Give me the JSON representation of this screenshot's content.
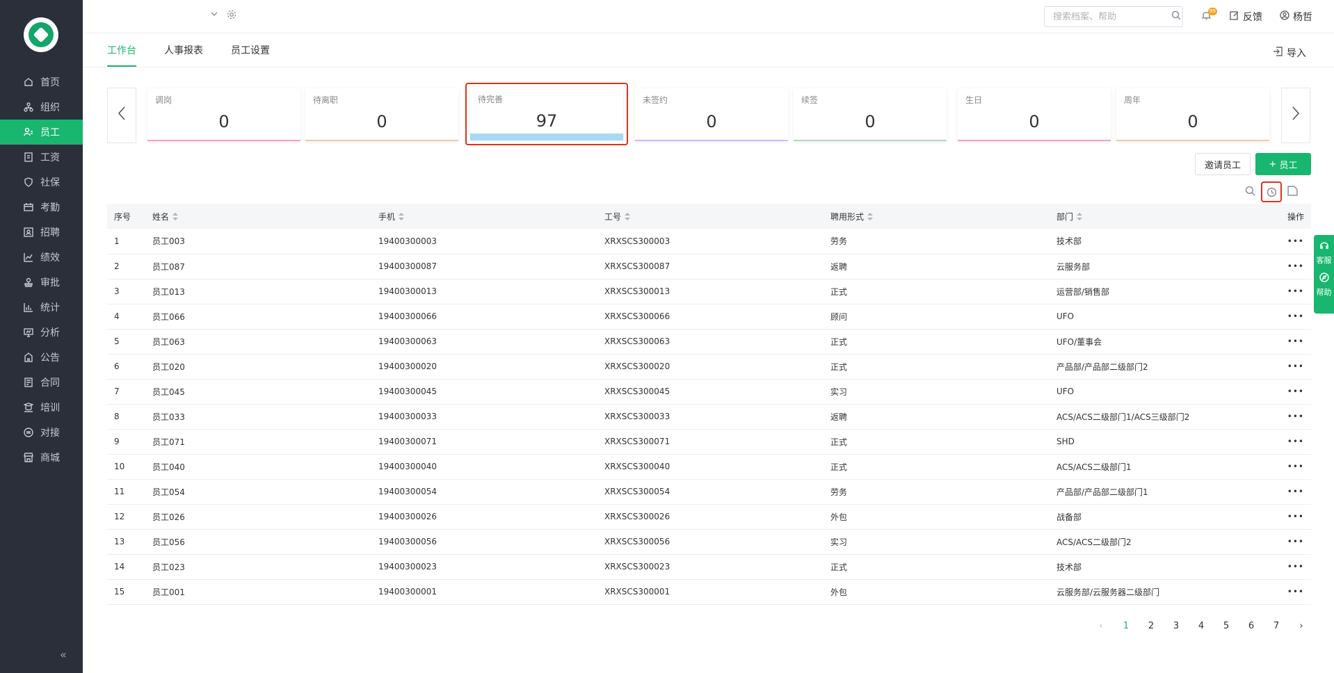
{
  "sidebar": {
    "items": [
      {
        "label": "首页",
        "icon": "home-icon"
      },
      {
        "label": "组织",
        "icon": "org-icon"
      },
      {
        "label": "员工",
        "icon": "employee-icon",
        "active": true
      },
      {
        "label": "工资",
        "icon": "salary-icon"
      },
      {
        "label": "社保",
        "icon": "shield-icon"
      },
      {
        "label": "考勤",
        "icon": "calendar-icon"
      },
      {
        "label": "招聘",
        "icon": "recruit-icon"
      },
      {
        "label": "绩效",
        "icon": "chart-line-icon"
      },
      {
        "label": "审批",
        "icon": "stamp-icon"
      },
      {
        "label": "统计",
        "icon": "bar-chart-icon"
      },
      {
        "label": "分析",
        "icon": "analysis-icon"
      },
      {
        "label": "公告",
        "icon": "notice-icon"
      },
      {
        "label": "合同",
        "icon": "contract-icon"
      },
      {
        "label": "培训",
        "icon": "training-icon"
      },
      {
        "label": "对接",
        "icon": "link-icon"
      },
      {
        "label": "商城",
        "icon": "store-icon"
      }
    ]
  },
  "header": {
    "search_placeholder": "搜索档案、帮助",
    "bell_badge": "99",
    "feedback_label": "反馈",
    "user_name": "杨哲"
  },
  "tabs": [
    {
      "label": "工作台",
      "active": true
    },
    {
      "label": "人事报表"
    },
    {
      "label": "员工设置"
    }
  ],
  "import_label": "导入",
  "cards": [
    {
      "label": "调岗",
      "value": "0",
      "color": "#f5a3b8"
    },
    {
      "label": "待离职",
      "value": "0",
      "color": "#f8c8a8"
    },
    {
      "label": "待完善",
      "value": "97",
      "color": "#a7d9f5"
    },
    {
      "label": "未签约",
      "value": "0",
      "color": "#d8b4f8"
    },
    {
      "label": "续签",
      "value": "0",
      "color": "#a8dcc0"
    },
    {
      "label": "生日",
      "value": "0",
      "color": "#f5a3b8"
    },
    {
      "label": "周年",
      "value": "0",
      "color": "#f8c8a8"
    }
  ],
  "actions": {
    "invite_label": "邀请员工",
    "add_label": "员工"
  },
  "table": {
    "headers": [
      "序号",
      "姓名",
      "手机",
      "工号",
      "聘用形式",
      "部门",
      "操作"
    ],
    "rows": [
      [
        "1",
        "员工003",
        "19400300003",
        "XRXSCS300003",
        "劳务",
        "技术部"
      ],
      [
        "2",
        "员工087",
        "19400300087",
        "XRXSCS300087",
        "返聘",
        "云服务部"
      ],
      [
        "3",
        "员工013",
        "19400300013",
        "XRXSCS300013",
        "正式",
        "运营部/销售部"
      ],
      [
        "4",
        "员工066",
        "19400300066",
        "XRXSCS300066",
        "顾问",
        "UFO"
      ],
      [
        "5",
        "员工063",
        "19400300063",
        "XRXSCS300063",
        "正式",
        "UFO/董事会"
      ],
      [
        "6",
        "员工020",
        "19400300020",
        "XRXSCS300020",
        "正式",
        "产品部/产品部二级部门2"
      ],
      [
        "7",
        "员工045",
        "19400300045",
        "XRXSCS300045",
        "实习",
        "UFO"
      ],
      [
        "8",
        "员工033",
        "19400300033",
        "XRXSCS300033",
        "返聘",
        "ACS/ACS二级部门1/ACS三级部门2"
      ],
      [
        "9",
        "员工071",
        "19400300071",
        "XRXSCS300071",
        "正式",
        "SHD"
      ],
      [
        "10",
        "员工040",
        "19400300040",
        "XRXSCS300040",
        "正式",
        "ACS/ACS二级部门1"
      ],
      [
        "11",
        "员工054",
        "19400300054",
        "XRXSCS300054",
        "劳务",
        "产品部/产品部二级部门1"
      ],
      [
        "12",
        "员工026",
        "19400300026",
        "XRXSCS300026",
        "外包",
        "战备部"
      ],
      [
        "13",
        "员工056",
        "19400300056",
        "XRXSCS300056",
        "实习",
        "ACS/ACS二级部门2"
      ],
      [
        "14",
        "员工023",
        "19400300023",
        "XRXSCS300023",
        "正式",
        "技术部"
      ],
      [
        "15",
        "员工001",
        "19400300001",
        "XRXSCS300001",
        "外包",
        "云服务部/云服务器二级部门"
      ]
    ],
    "more_label": "•••"
  },
  "pagination": {
    "prev": "‹",
    "pages": [
      "1",
      "2",
      "3",
      "4",
      "5",
      "6",
      "7"
    ],
    "current": "1",
    "next": "›"
  },
  "float_widget": {
    "service_label": "客服",
    "help_label": "帮助"
  },
  "colors": {
    "brand": "#18b66e",
    "sidebar_bg": "#2b2f3a",
    "highlight": "#e0311e"
  }
}
